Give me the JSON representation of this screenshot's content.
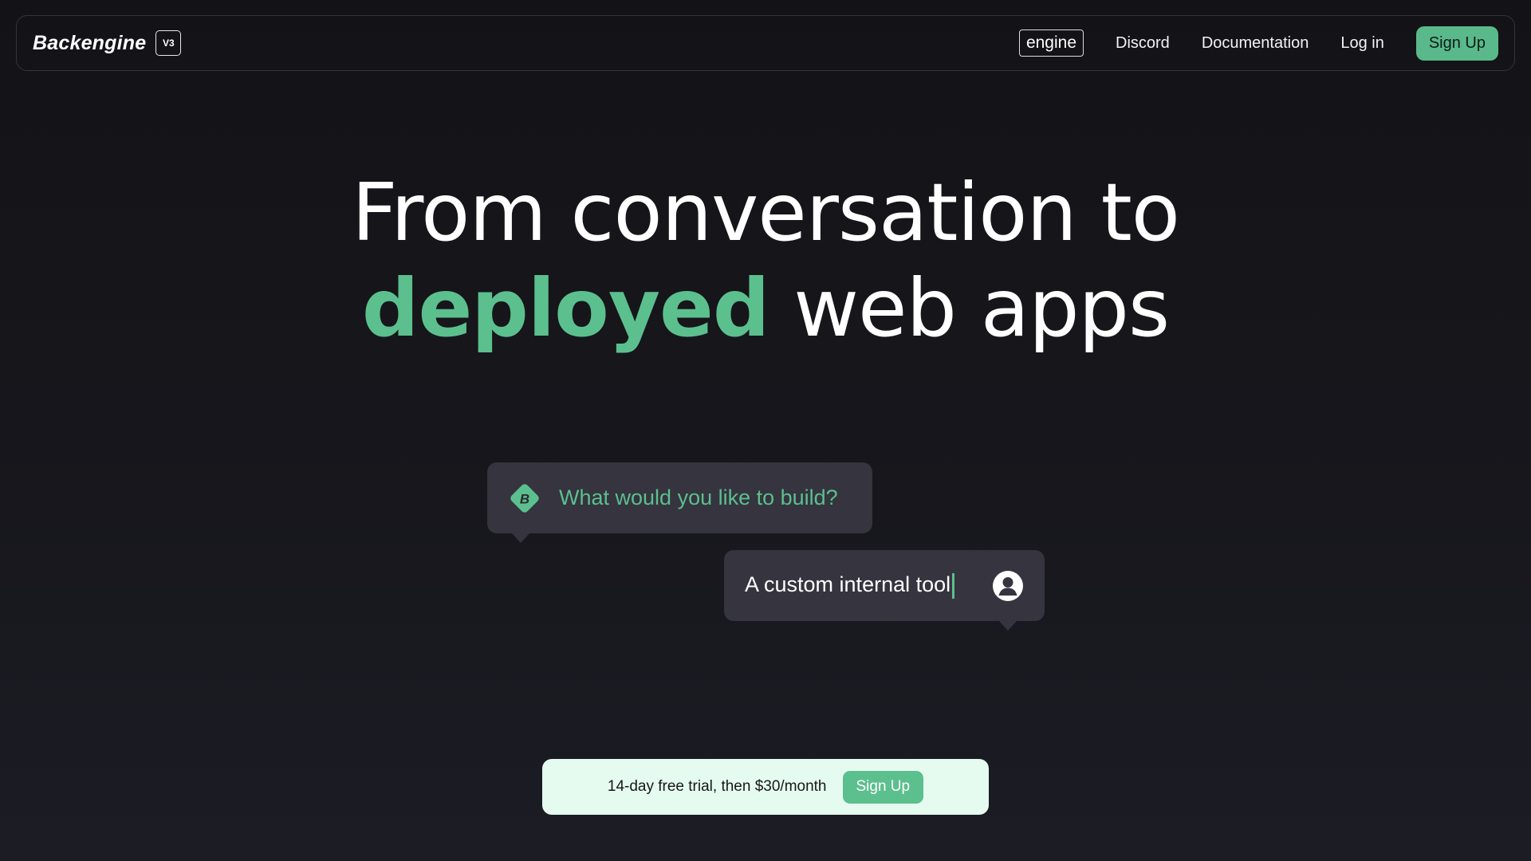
{
  "nav": {
    "brand": "Backengine",
    "version": "V3",
    "links": {
      "engine": "engine",
      "discord": "Discord",
      "documentation": "Documentation",
      "login": "Log in"
    },
    "signup": "Sign Up"
  },
  "hero": {
    "line1": "From conversation to",
    "accent": "deployed",
    "line2_rest": " web apps"
  },
  "chat": {
    "ai_icon": "backengine-diamond-icon",
    "ai_prompt": "What would you like to build?",
    "user_input": "A custom internal tool",
    "user_icon": "user-avatar-icon"
  },
  "trial": {
    "text": "14-day free trial, then $30/month",
    "signup": "Sign Up"
  },
  "colors": {
    "accent": "#5cbf8e",
    "background": "#131317",
    "bubble": "#35343f",
    "trial_bg": "#e6fbf0"
  }
}
